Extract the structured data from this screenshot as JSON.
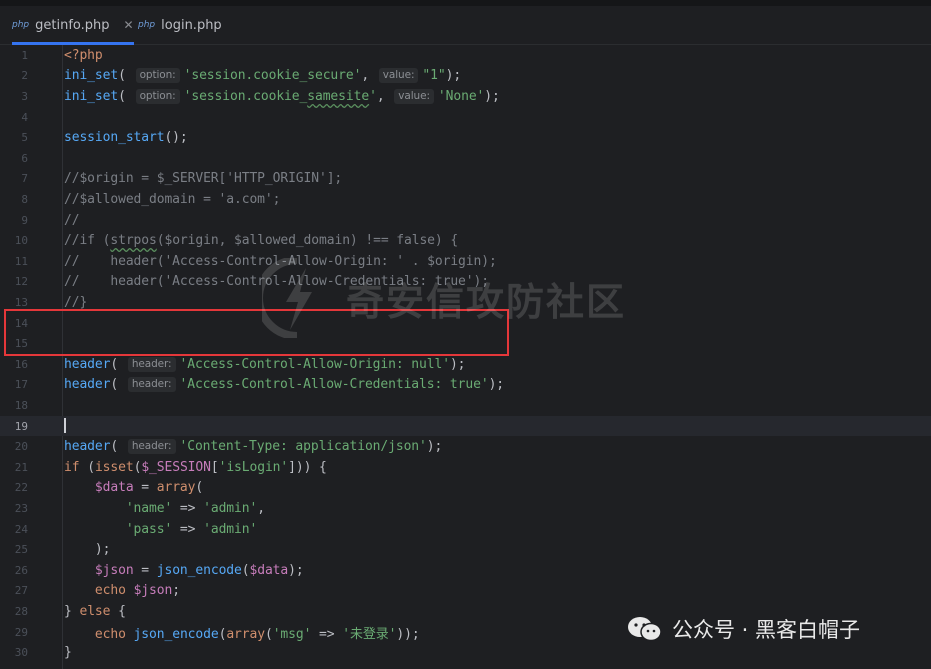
{
  "tabs": [
    {
      "label": "getinfo.php",
      "file_icon": "php",
      "active": true
    },
    {
      "label": "login.php",
      "file_icon": "php",
      "active": false
    }
  ],
  "close_glyph": "✕",
  "current_line": 19,
  "lines": [
    {
      "n": "1",
      "tokens": [
        [
          "kw",
          "<?php"
        ]
      ]
    },
    {
      "n": "2",
      "tokens": [
        [
          "fn",
          "ini_set"
        ],
        [
          "p",
          "( "
        ],
        [
          "hint",
          "option:"
        ],
        [
          "str",
          "'session.cookie_secure'"
        ],
        [
          "p",
          ", "
        ],
        [
          "hint",
          "value:"
        ],
        [
          "str",
          "\"1\""
        ],
        [
          "p",
          ");"
        ]
      ]
    },
    {
      "n": "3",
      "tokens": [
        [
          "fn",
          "ini_set"
        ],
        [
          "p",
          "( "
        ],
        [
          "hint",
          "option:"
        ],
        [
          "str",
          "'session.cookie_"
        ],
        [
          "strw",
          "samesite"
        ],
        [
          "str",
          "'"
        ],
        [
          "p",
          ", "
        ],
        [
          "hint",
          "value:"
        ],
        [
          "str",
          "'None'"
        ],
        [
          "p",
          ");"
        ]
      ]
    },
    {
      "n": "4",
      "tokens": []
    },
    {
      "n": "5",
      "tokens": [
        [
          "fn",
          "session_start"
        ],
        [
          "p",
          "();"
        ]
      ]
    },
    {
      "n": "6",
      "tokens": []
    },
    {
      "n": "7",
      "tokens": [
        [
          "cm",
          "//$origin = $_SERVER['HTTP_ORIGIN'];"
        ]
      ]
    },
    {
      "n": "8",
      "tokens": [
        [
          "cm",
          "//$allowed_domain = 'a.com';"
        ]
      ]
    },
    {
      "n": "9",
      "tokens": [
        [
          "cm",
          "//"
        ]
      ]
    },
    {
      "n": "10",
      "tokens": [
        [
          "cm",
          "//if ("
        ],
        [
          "cmw",
          "strpos"
        ],
        [
          "cm",
          "($origin, $allowed_domain) !== false) {"
        ]
      ]
    },
    {
      "n": "11",
      "tokens": [
        [
          "cm",
          "//    header('Access-Control-Allow-Origin: ' . $origin);"
        ]
      ]
    },
    {
      "n": "12",
      "tokens": [
        [
          "cm",
          "//    header('Access-Control-Allow-Credentials: true');"
        ]
      ]
    },
    {
      "n": "13",
      "tokens": [
        [
          "cm",
          "//}"
        ]
      ]
    },
    {
      "n": "14",
      "tokens": []
    },
    {
      "n": "15",
      "tokens": []
    },
    {
      "n": "16",
      "tokens": [
        [
          "fn",
          "header"
        ],
        [
          "p",
          "( "
        ],
        [
          "hint",
          "header:"
        ],
        [
          "str",
          "'Access-Control-Allow-Origin: null'"
        ],
        [
          "p",
          ");"
        ]
      ]
    },
    {
      "n": "17",
      "tokens": [
        [
          "fn",
          "header"
        ],
        [
          "p",
          "( "
        ],
        [
          "hint",
          "header:"
        ],
        [
          "str",
          "'Access-Control-Allow-Credentials: true'"
        ],
        [
          "p",
          ");"
        ]
      ]
    },
    {
      "n": "18",
      "tokens": []
    },
    {
      "n": "19",
      "tokens": [
        [
          "cursor",
          ""
        ]
      ]
    },
    {
      "n": "20",
      "tokens": [
        [
          "fn",
          "header"
        ],
        [
          "p",
          "( "
        ],
        [
          "hint",
          "header:"
        ],
        [
          "str",
          "'Content-Type: application/json'"
        ],
        [
          "p",
          ");"
        ]
      ]
    },
    {
      "n": "21",
      "tokens": [
        [
          "kw",
          "if"
        ],
        [
          "p",
          " ("
        ],
        [
          "kw",
          "isset"
        ],
        [
          "p",
          "("
        ],
        [
          "var",
          "$_SESSION"
        ],
        [
          "p",
          "["
        ],
        [
          "str",
          "'isLogin'"
        ],
        [
          "p",
          "])) {"
        ]
      ]
    },
    {
      "n": "22",
      "tokens": [
        [
          "p",
          "    "
        ],
        [
          "var",
          "$data"
        ],
        [
          "p",
          " = "
        ],
        [
          "kw",
          "array"
        ],
        [
          "p",
          "("
        ]
      ]
    },
    {
      "n": "23",
      "tokens": [
        [
          "p",
          "        "
        ],
        [
          "str",
          "'name'"
        ],
        [
          "p",
          " => "
        ],
        [
          "str",
          "'admin'"
        ],
        [
          "p",
          ","
        ]
      ]
    },
    {
      "n": "24",
      "tokens": [
        [
          "p",
          "        "
        ],
        [
          "str",
          "'pass'"
        ],
        [
          "p",
          " => "
        ],
        [
          "str",
          "'admin'"
        ]
      ]
    },
    {
      "n": "25",
      "tokens": [
        [
          "p",
          "    );"
        ]
      ]
    },
    {
      "n": "26",
      "tokens": [
        [
          "p",
          "    "
        ],
        [
          "var",
          "$json"
        ],
        [
          "p",
          " = "
        ],
        [
          "fn",
          "json_encode"
        ],
        [
          "p",
          "("
        ],
        [
          "var",
          "$data"
        ],
        [
          "p",
          ");"
        ]
      ]
    },
    {
      "n": "27",
      "tokens": [
        [
          "p",
          "    "
        ],
        [
          "kw",
          "echo"
        ],
        [
          "p",
          " "
        ],
        [
          "var",
          "$json"
        ],
        [
          "p",
          ";"
        ]
      ]
    },
    {
      "n": "28",
      "tokens": [
        [
          "p",
          "} "
        ],
        [
          "kw",
          "else"
        ],
        [
          "p",
          " {"
        ]
      ]
    },
    {
      "n": "29",
      "tokens": [
        [
          "p",
          "    "
        ],
        [
          "kw",
          "echo"
        ],
        [
          "p",
          " "
        ],
        [
          "fn",
          "json_encode"
        ],
        [
          "p",
          "("
        ],
        [
          "kw",
          "array"
        ],
        [
          "p",
          "("
        ],
        [
          "str",
          "'msg'"
        ],
        [
          "p",
          " => "
        ],
        [
          "str",
          "'未登录'"
        ],
        [
          "p",
          "));"
        ]
      ]
    },
    {
      "n": "30",
      "tokens": [
        [
          "p",
          "}"
        ]
      ]
    }
  ],
  "watermark_text": "奇安信攻防社区",
  "brand": {
    "text": "公众号 · 黑客白帽子"
  },
  "colors": {
    "accent": "#3574f0",
    "highlight_box": "#e5373a",
    "keyword": "#cf8e6d",
    "function": "#56a8f5",
    "string": "#6aab73",
    "variable": "#c77dbb",
    "comment": "#7a7e85"
  }
}
